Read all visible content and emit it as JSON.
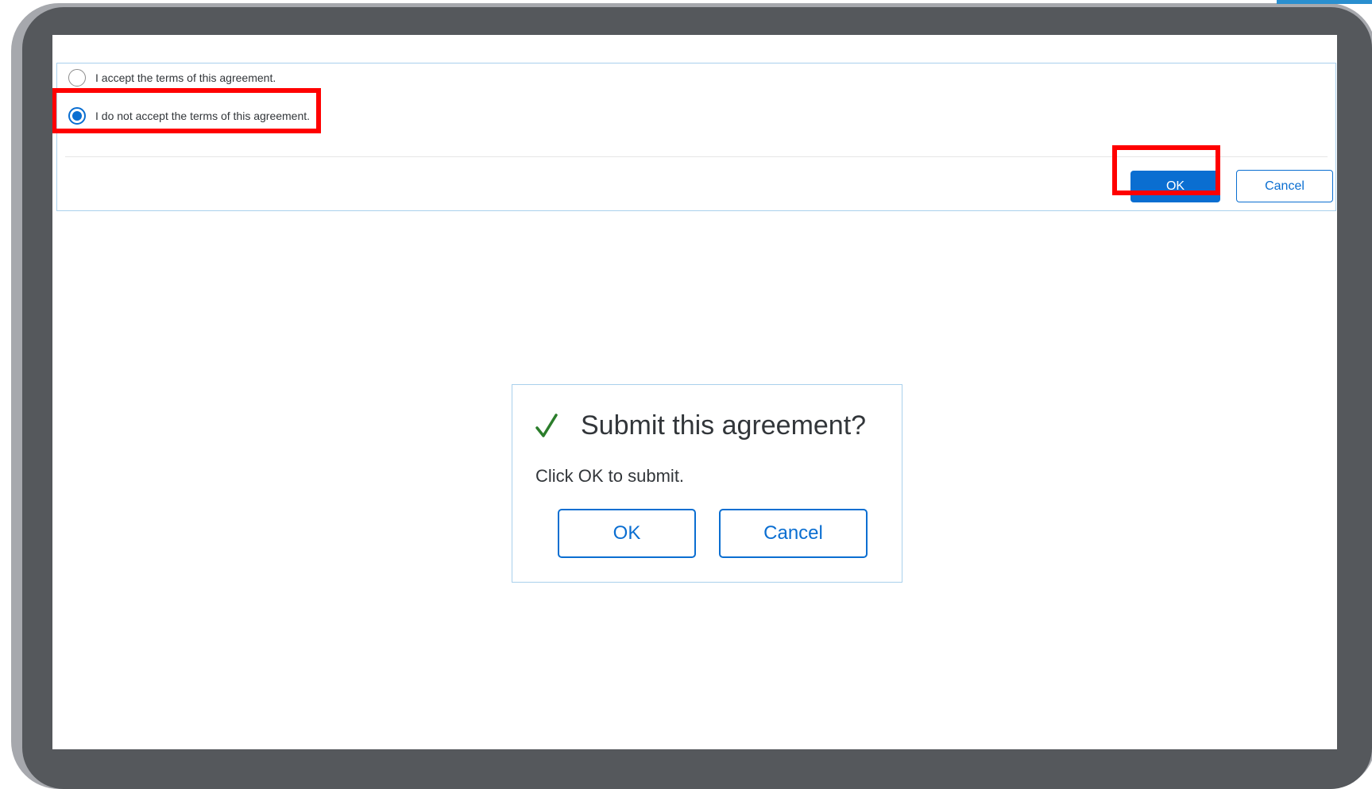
{
  "colors": {
    "accent": "#0a6ed1",
    "highlight": "#ff0000",
    "check": "#2b7d2b",
    "text": "#32363a",
    "frame": "#55585c"
  },
  "agreement": {
    "options": [
      {
        "label": "I accept the terms of this agreement.",
        "selected": false
      },
      {
        "label": "I do not accept the terms of this agreement.",
        "selected": true
      }
    ],
    "ok_label": "OK",
    "cancel_label": "Cancel"
  },
  "dialog": {
    "icon": "checkmark-icon",
    "title": "Submit this agreement?",
    "message": "Click OK to submit.",
    "ok_label": "OK",
    "cancel_label": "Cancel"
  }
}
